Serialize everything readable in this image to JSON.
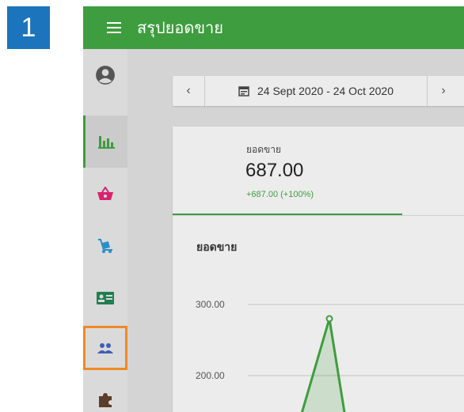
{
  "step_number": "1",
  "app": {
    "title": "สรุปยอดขาย",
    "accent_color": "#3e9d3e",
    "highlight_color": "#f08a24"
  },
  "sidebar": {
    "items": [
      {
        "icon": "account-circle-icon",
        "active": false
      },
      {
        "icon": "bar-chart-icon",
        "active": true
      },
      {
        "icon": "basket-icon",
        "active": false
      },
      {
        "icon": "hand-truck-icon",
        "active": false
      },
      {
        "icon": "contact-card-icon",
        "active": false
      },
      {
        "icon": "people-icon",
        "active": false,
        "highlighted": true
      },
      {
        "icon": "puzzle-icon",
        "active": false
      }
    ]
  },
  "date_range": {
    "prev_icon": "chevron-left-icon",
    "calendar_icon": "calendar-icon",
    "label": "24 Sept 2020 - 24 Oct 2020",
    "next_icon": "chevron-right-icon"
  },
  "kpi": {
    "label": "ยอดขาย",
    "value": "687.00",
    "change": "+687.00 (+100%)"
  },
  "chart_data": {
    "type": "area",
    "title": "ยอดขาย",
    "y_ticks": [
      "300.00",
      "200.00"
    ],
    "series": [
      {
        "values": [
          null,
          280,
          null
        ]
      }
    ],
    "ylim": [
      150,
      330
    ],
    "grid": true
  }
}
